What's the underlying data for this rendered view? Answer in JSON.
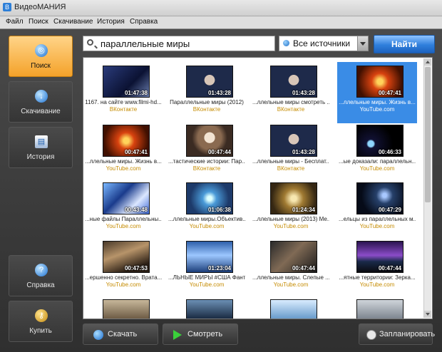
{
  "window": {
    "title": "ВидеоМАНИЯ"
  },
  "menu": [
    "Файл",
    "Поиск",
    "Скачивание",
    "История",
    "Справка"
  ],
  "sidebar": [
    {
      "label": "Поиск",
      "icon": "search-globe-icon",
      "active": true
    },
    {
      "label": "Скачивание",
      "icon": "download-globe-icon",
      "active": false
    },
    {
      "label": "История",
      "icon": "history-icon",
      "active": false
    },
    {
      "label": "Справка",
      "icon": "help-icon",
      "active": false
    },
    {
      "label": "Купить",
      "icon": "keys-icon",
      "active": false
    }
  ],
  "search": {
    "value": "параллельные миры",
    "placeholder": ""
  },
  "source": {
    "selected": "Все источники"
  },
  "find_label": "Найти",
  "results": [
    {
      "dur": "01:47:38",
      "cap": "1167. на сайте www.filmi-hd...",
      "src": "ВКонтакте",
      "th": "t-news"
    },
    {
      "dur": "01:43:28",
      "cap": "Параллельные миры (2012)",
      "src": "ВКонтакте",
      "th": "t-man"
    },
    {
      "dur": "01:43:28",
      "cap": "...ллельные миры смотреть ...",
      "src": "ВКонтакте",
      "th": "t-man"
    },
    {
      "dur": "00:47:41",
      "cap": "...ллельные миры. Жизнь в...",
      "src": "YouTube.com",
      "th": "t-red",
      "selected": true
    },
    {
      "dur": "00:47:41",
      "cap": "...ллельные миры. Жизнь в...",
      "src": "YouTube.com",
      "th": "t-red"
    },
    {
      "dur": "00:47:44",
      "cap": "...тастические истории: Пар...",
      "src": "ВКонтакте",
      "th": "t-woman"
    },
    {
      "dur": "01:43:28",
      "cap": "...ллельные миры - Бесплат...",
      "src": "ВКонтакте",
      "th": "t-man"
    },
    {
      "dur": "00:46:33",
      "cap": "...ые доказали: параллельн...",
      "src": "YouTube.com",
      "th": "t-planet"
    },
    {
      "dur": "00:43:48",
      "cap": "...ные файлы Параллельны...",
      "src": "YouTube.com",
      "th": "t-frac"
    },
    {
      "dur": "01:06:38",
      "cap": "...ллельные миры.Объектив...",
      "src": "YouTube.com",
      "th": "t-blue"
    },
    {
      "dur": "01:24:34",
      "cap": "...ллельные миры (2013) Ме...",
      "src": "YouTube.com",
      "th": "t-gold"
    },
    {
      "dur": "00:47:29",
      "cap": "...ельцы из параллельных м...",
      "src": "YouTube.com",
      "th": "t-cosmos"
    },
    {
      "dur": "00:47:53",
      "cap": "...ершенно секретно. Врата...",
      "src": "YouTube.com",
      "th": "t-cave"
    },
    {
      "dur": "01:23:04",
      "cap": "...ЛЬНЫЕ МИРЫ #США Фант...",
      "src": "YouTube.com",
      "th": "t-tv"
    },
    {
      "dur": "00:47:44",
      "cap": "...ллельные миры. Слепые ...",
      "src": "YouTube.com",
      "th": "t-ruin"
    },
    {
      "dur": "00:47:44",
      "cap": "...ятные территории: Зерка...",
      "src": "YouTube.com",
      "th": "t-purple"
    },
    {
      "dur": "",
      "cap": "",
      "src": "",
      "th": "t-city"
    },
    {
      "dur": "",
      "cap": "",
      "src": "",
      "th": "t-dark"
    },
    {
      "dur": "",
      "cap": "",
      "src": "",
      "th": "t-sky"
    },
    {
      "dur": "",
      "cap": "",
      "src": "",
      "th": "t-grey"
    }
  ],
  "bottom": {
    "download": "Скачать",
    "watch": "Смотреть",
    "schedule": "Запланировать"
  }
}
